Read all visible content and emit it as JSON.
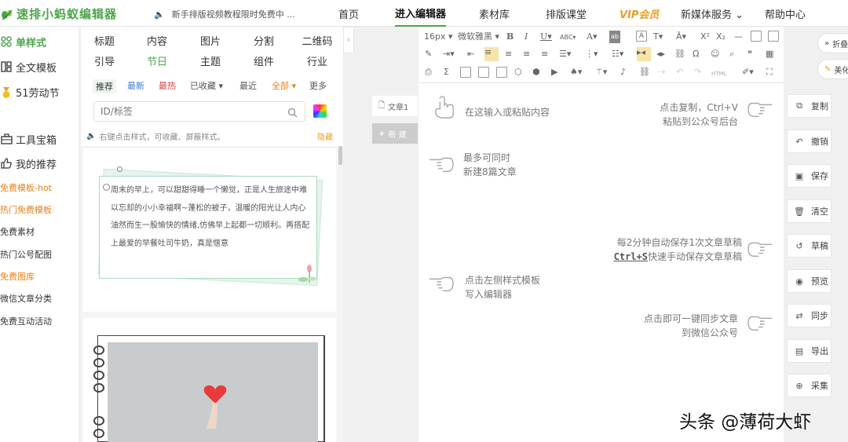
{
  "app": {
    "logo_text": "速排小蚂蚁编辑器",
    "announcement": "新手排版视频教程限时免费中 ...",
    "accent": "#4da54a"
  },
  "topnav": {
    "items": [
      {
        "label": "首页"
      },
      {
        "label": "进入编辑器"
      },
      {
        "label": "素材库"
      },
      {
        "label": "排版课堂"
      },
      {
        "label": "VIP会员"
      },
      {
        "label": "新媒体服务 ⌄"
      },
      {
        "label": "帮助中心"
      }
    ]
  },
  "leftnav": {
    "main": [
      {
        "label": "单样式",
        "icon": "grid-icon"
      },
      {
        "label": "全文模板",
        "icon": "layout-icon"
      },
      {
        "label": "51劳动节",
        "icon": "medal-icon"
      }
    ],
    "tools": [
      {
        "label": "工具宝箱",
        "icon": "toolbox-icon"
      },
      {
        "label": "我的推荐",
        "icon": "thumbs-up-icon"
      }
    ],
    "links": [
      {
        "label": "免费模板-hot",
        "color": "orange"
      },
      {
        "label": "热门免费模板",
        "color": "orange"
      },
      {
        "label": "免费素材",
        "color": "dark"
      },
      {
        "label": "热门公号配图",
        "color": "dark"
      },
      {
        "label": "免费图库",
        "color": "orange"
      },
      {
        "label": "微信文章分类",
        "color": "dark"
      },
      {
        "label": "免费互动活动",
        "color": "dark"
      }
    ]
  },
  "stylepanel": {
    "categories_row1": [
      "标题",
      "内容",
      "图片",
      "分割",
      "二维码"
    ],
    "categories_row2": [
      "引导",
      "节日",
      "主题",
      "组件",
      "行业"
    ],
    "filters": [
      "推荐",
      "最新",
      "最热",
      "已收藏 ▾",
      "最近",
      "全部 ▾",
      "更多"
    ],
    "search_placeholder": "ID/标签",
    "tip": "右键点击样式，可收藏、屏蔽样式。",
    "tip_link": "隐藏",
    "card_text": "周末的早上，可以甜甜得睡一个懒觉，正是人生旅途中难以忘却的小小幸福啊~蓬松的被子，温暖的阳光让人内心油然而生一股愉快的情绪,仿佛早上起都一切顺利。再搭配上最爱的早餐吐司牛奶，真是惬意"
  },
  "docs": {
    "tab_label": "文章1",
    "new_label": "新 建"
  },
  "toolbar": {
    "font_size": "16px ▾",
    "font_family": "微软雅黑 ▾"
  },
  "editor_hints": {
    "paste": "在这输入或粘贴内容",
    "copy": "点击复制，Ctrl+V\n粘贴到公众号后台",
    "max": "最多可同时\n新建8篇文章",
    "autosave_line1": "每2分钟自动保存1次文章草稿",
    "autosave_key": "Ctrl+S",
    "autosave_line2": "快速手动保存文章草稿",
    "template": "点击左侧样式模板\n写入编辑器",
    "sync": "点击即可一键同步文章\n到微信公众号"
  },
  "rightpanel": {
    "top_tabs": [
      "折叠",
      "美化"
    ],
    "buttons": [
      {
        "label": "复制",
        "icon": "copy-icon"
      },
      {
        "label": "撤销",
        "icon": "undo-icon"
      },
      {
        "label": "保存",
        "icon": "save-icon"
      },
      {
        "label": "清空",
        "icon": "trash-icon"
      },
      {
        "label": "草稿",
        "icon": "draft-icon"
      },
      {
        "label": "预览",
        "icon": "eye-icon"
      },
      {
        "label": "同步",
        "icon": "sync-icon"
      },
      {
        "label": "导出",
        "icon": "export-icon"
      },
      {
        "label": "采集",
        "icon": "collect-icon"
      }
    ]
  },
  "watermark": "头条 @薄荷大虾"
}
